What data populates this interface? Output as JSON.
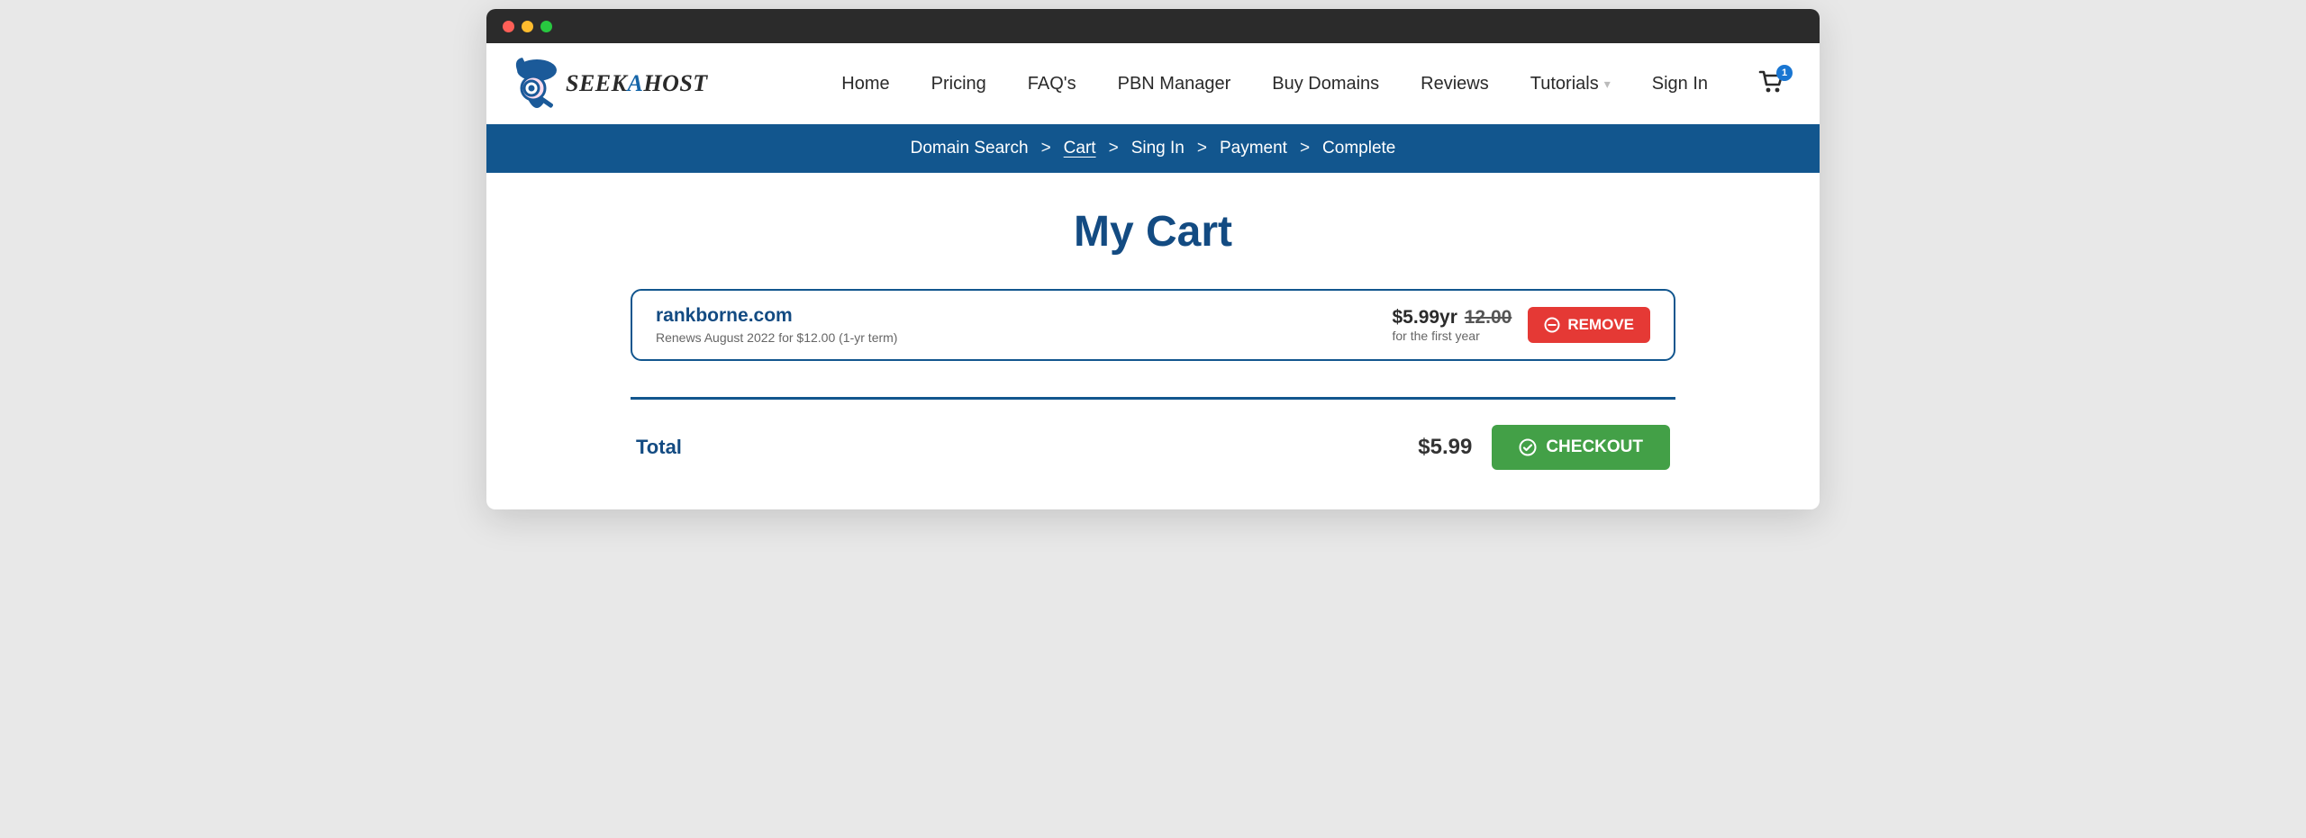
{
  "logo": {
    "text_before": "SEEK",
    "text_a": "A",
    "text_after": "HOST"
  },
  "nav": {
    "items": [
      "Home",
      "Pricing",
      "FAQ's",
      "PBN Manager",
      "Buy Domains",
      "Reviews",
      "Tutorials",
      "Sign In"
    ],
    "cart_count": "1"
  },
  "breadcrumb": {
    "steps": [
      "Domain Search",
      "Cart",
      "Sing In",
      "Payment",
      "Complete"
    ],
    "current_index": 1
  },
  "page_title": "My Cart",
  "cart": {
    "item": {
      "domain": "rankborne.com",
      "renew_text": "Renews August 2022 for $12.00 (1-yr term)",
      "price": "$5.99yr",
      "strike_price": "12.00",
      "price_sub": "for the first year",
      "remove_label": "REMOVE"
    }
  },
  "total": {
    "label": "Total",
    "amount": "$5.99",
    "checkout_label": "CHECKOUT"
  }
}
